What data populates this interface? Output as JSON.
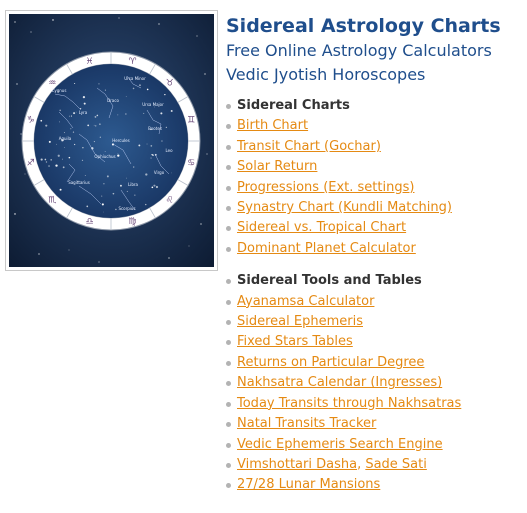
{
  "header": {
    "title": "Sidereal Astrology Charts",
    "subtitle1": "Free Online Astrology Calculators",
    "subtitle2": "Vedic Jyotish Horoscopes"
  },
  "image": {
    "constellations": [
      "Cygnus",
      "Lyra",
      "Ursa Minor",
      "Draco",
      "Ursa Major",
      "Aquila",
      "Hercules",
      "Bootes",
      "Leo",
      "Ophiuchus",
      "Virgo",
      "Sagittarius",
      "Libra",
      "Scorpius"
    ]
  },
  "sections": [
    {
      "heading": "Sidereal Charts",
      "links": [
        "Birth Chart",
        "Transit Chart (Gochar)",
        "Solar Return",
        "Progressions (Ext. settings)",
        "Synastry Chart (Kundli Matching)",
        "Sidereal vs. Tropical Chart",
        "Dominant Planet Calculator"
      ]
    },
    {
      "heading": "Sidereal Tools and Tables",
      "links": [
        "Ayanamsa Calculator",
        "Sidereal Ephemeris",
        "Fixed Stars Tables",
        "Returns on Particular Degree",
        "Nakhsatra Calendar (Ingresses)",
        "Today Transits through Nakhsatras",
        "Natal Transits Tracker",
        "Vedic Ephemeris Search Engine"
      ],
      "combo": {
        "link1": "Vimshottari Dasha",
        "separator": ", ",
        "link2": "Sade Sati"
      },
      "last_link": "27/28 Lunar Mansions"
    }
  ]
}
